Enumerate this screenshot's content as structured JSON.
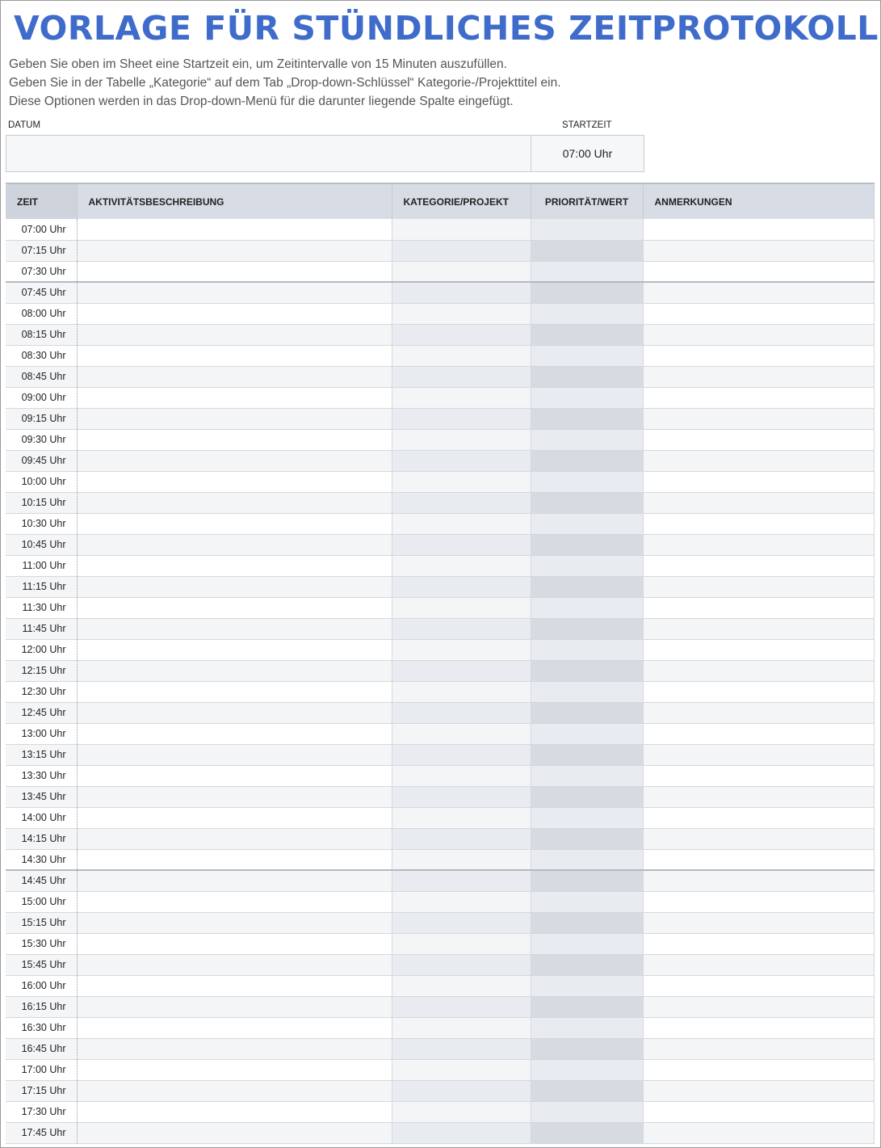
{
  "title": "VORLAGE FÜR STÜNDLICHES ZEITPROTOKOLL",
  "instructions": [
    "Geben Sie oben im Sheet eine Startzeit ein, um Zeitintervalle von 15 Minuten auszufüllen.",
    "Geben Sie in der Tabelle „Kategorie“ auf dem Tab „Drop-down-Schlüssel“ Kategorie-/Projekttitel ein.",
    "Diese Optionen werden in das Drop-down-Menü für die darunter liegende Spalte eingefügt."
  ],
  "date_label": "DATUM",
  "date_value": "",
  "start_label": "STARTZEIT",
  "start_value": "07:00 Uhr",
  "columns": {
    "time": "ZEIT",
    "activity": "AKTIVITÄTSBESCHREIBUNG",
    "category": "KATEGORIE/PROJEKT",
    "priority": "PRIORITÄT/WERT",
    "notes": "ANMERKUNGEN"
  },
  "rows": [
    {
      "time": "07:00 Uhr",
      "activity": "",
      "category": "",
      "priority": "",
      "notes": ""
    },
    {
      "time": "07:15 Uhr",
      "activity": "",
      "category": "",
      "priority": "",
      "notes": ""
    },
    {
      "time": "07:30 Uhr",
      "activity": "",
      "category": "",
      "priority": "",
      "notes": ""
    },
    {
      "time": "07:45 Uhr",
      "activity": "",
      "category": "",
      "priority": "",
      "notes": ""
    },
    {
      "time": "08:00 Uhr",
      "activity": "",
      "category": "",
      "priority": "",
      "notes": ""
    },
    {
      "time": "08:15 Uhr",
      "activity": "",
      "category": "",
      "priority": "",
      "notes": ""
    },
    {
      "time": "08:30 Uhr",
      "activity": "",
      "category": "",
      "priority": "",
      "notes": ""
    },
    {
      "time": "08:45 Uhr",
      "activity": "",
      "category": "",
      "priority": "",
      "notes": ""
    },
    {
      "time": "09:00 Uhr",
      "activity": "",
      "category": "",
      "priority": "",
      "notes": ""
    },
    {
      "time": "09:15 Uhr",
      "activity": "",
      "category": "",
      "priority": "",
      "notes": ""
    },
    {
      "time": "09:30 Uhr",
      "activity": "",
      "category": "",
      "priority": "",
      "notes": ""
    },
    {
      "time": "09:45 Uhr",
      "activity": "",
      "category": "",
      "priority": "",
      "notes": ""
    },
    {
      "time": "10:00 Uhr",
      "activity": "",
      "category": "",
      "priority": "",
      "notes": ""
    },
    {
      "time": "10:15 Uhr",
      "activity": "",
      "category": "",
      "priority": "",
      "notes": ""
    },
    {
      "time": "10:30 Uhr",
      "activity": "",
      "category": "",
      "priority": "",
      "notes": ""
    },
    {
      "time": "10:45 Uhr",
      "activity": "",
      "category": "",
      "priority": "",
      "notes": ""
    },
    {
      "time": "11:00 Uhr",
      "activity": "",
      "category": "",
      "priority": "",
      "notes": ""
    },
    {
      "time": "11:15 Uhr",
      "activity": "",
      "category": "",
      "priority": "",
      "notes": ""
    },
    {
      "time": "11:30 Uhr",
      "activity": "",
      "category": "",
      "priority": "",
      "notes": ""
    },
    {
      "time": "11:45 Uhr",
      "activity": "",
      "category": "",
      "priority": "",
      "notes": ""
    },
    {
      "time": "12:00 Uhr",
      "activity": "",
      "category": "",
      "priority": "",
      "notes": ""
    },
    {
      "time": "12:15 Uhr",
      "activity": "",
      "category": "",
      "priority": "",
      "notes": ""
    },
    {
      "time": "12:30 Uhr",
      "activity": "",
      "category": "",
      "priority": "",
      "notes": ""
    },
    {
      "time": "12:45 Uhr",
      "activity": "",
      "category": "",
      "priority": "",
      "notes": ""
    },
    {
      "time": "13:00 Uhr",
      "activity": "",
      "category": "",
      "priority": "",
      "notes": ""
    },
    {
      "time": "13:15 Uhr",
      "activity": "",
      "category": "",
      "priority": "",
      "notes": ""
    },
    {
      "time": "13:30 Uhr",
      "activity": "",
      "category": "",
      "priority": "",
      "notes": ""
    },
    {
      "time": "13:45 Uhr",
      "activity": "",
      "category": "",
      "priority": "",
      "notes": ""
    },
    {
      "time": "14:00 Uhr",
      "activity": "",
      "category": "",
      "priority": "",
      "notes": ""
    },
    {
      "time": "14:15 Uhr",
      "activity": "",
      "category": "",
      "priority": "",
      "notes": ""
    },
    {
      "time": "14:30 Uhr",
      "activity": "",
      "category": "",
      "priority": "",
      "notes": ""
    },
    {
      "time": "14:45 Uhr",
      "activity": "",
      "category": "",
      "priority": "",
      "notes": ""
    },
    {
      "time": "15:00 Uhr",
      "activity": "",
      "category": "",
      "priority": "",
      "notes": ""
    },
    {
      "time": "15:15 Uhr",
      "activity": "",
      "category": "",
      "priority": "",
      "notes": ""
    },
    {
      "time": "15:30 Uhr",
      "activity": "",
      "category": "",
      "priority": "",
      "notes": ""
    },
    {
      "time": "15:45 Uhr",
      "activity": "",
      "category": "",
      "priority": "",
      "notes": ""
    },
    {
      "time": "16:00 Uhr",
      "activity": "",
      "category": "",
      "priority": "",
      "notes": ""
    },
    {
      "time": "16:15 Uhr",
      "activity": "",
      "category": "",
      "priority": "",
      "notes": ""
    },
    {
      "time": "16:30 Uhr",
      "activity": "",
      "category": "",
      "priority": "",
      "notes": ""
    },
    {
      "time": "16:45 Uhr",
      "activity": "",
      "category": "",
      "priority": "",
      "notes": ""
    },
    {
      "time": "17:00 Uhr",
      "activity": "",
      "category": "",
      "priority": "",
      "notes": ""
    },
    {
      "time": "17:15 Uhr",
      "activity": "",
      "category": "",
      "priority": "",
      "notes": ""
    },
    {
      "time": "17:30 Uhr",
      "activity": "",
      "category": "",
      "priority": "",
      "notes": ""
    },
    {
      "time": "17:45 Uhr",
      "activity": "",
      "category": "",
      "priority": "",
      "notes": ""
    }
  ]
}
